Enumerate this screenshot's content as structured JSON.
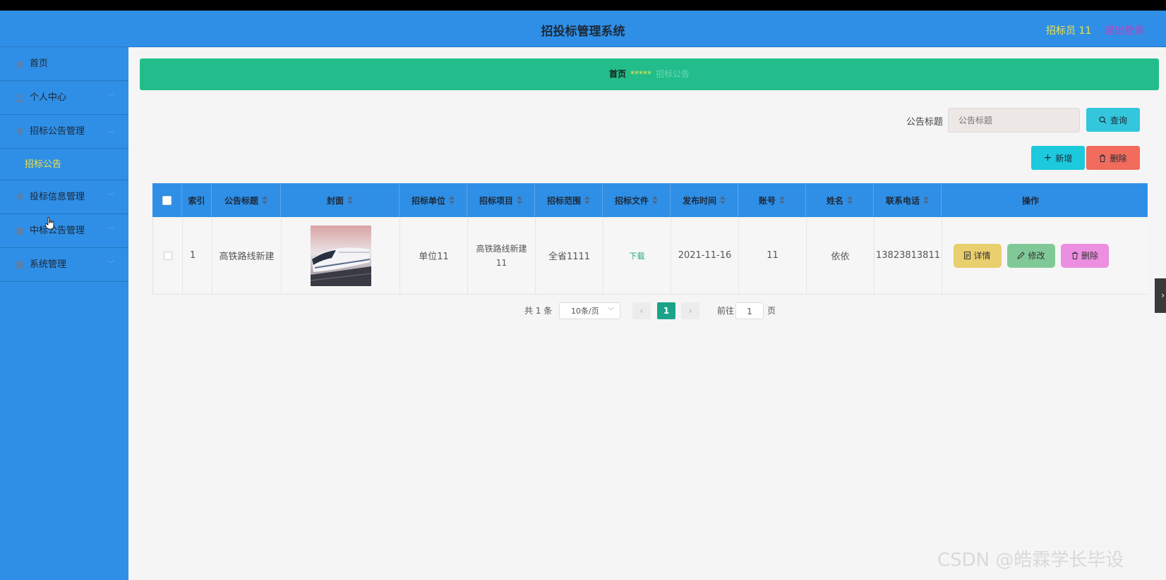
{
  "header": {
    "title": "招投标管理系统",
    "user": "招标员 11",
    "logout": "退出登录"
  },
  "sidebar": {
    "items": [
      {
        "label": "首页",
        "icon": "home-icon"
      },
      {
        "label": "个人中心",
        "icon": "user-icon"
      },
      {
        "label": "招标公告管理",
        "icon": "pin-icon"
      },
      {
        "label": "招标公告",
        "icon": ""
      },
      {
        "label": "投标信息管理",
        "icon": "pin-icon"
      },
      {
        "label": "中标公告管理",
        "icon": "book-icon"
      },
      {
        "label": "系统管理",
        "icon": "grid-icon"
      }
    ]
  },
  "breadcrumb": {
    "home": "首页",
    "separator": "*****",
    "current": "招标公告"
  },
  "search": {
    "label": "公告标题",
    "placeholder": "公告标题",
    "button": "查询"
  },
  "actions": {
    "add": "新增",
    "delete": "删除"
  },
  "table": {
    "headers": [
      "索引",
      "公告标题",
      "封面",
      "招标单位",
      "招标项目",
      "招标范围",
      "招标文件",
      "发布时间",
      "账号",
      "姓名",
      "联系电话",
      "操作"
    ],
    "rows": [
      {
        "index": "1",
        "title": "高铁路线新建",
        "unit": "单位11",
        "project": "高铁路线新建11",
        "scope": "全省1111",
        "file": "下载",
        "date": "2021-11-16",
        "account": "11",
        "name": "依依",
        "phone": "13823813811",
        "ops": {
          "detail": "详情",
          "edit": "修改",
          "delete": "删除"
        }
      }
    ]
  },
  "pagination": {
    "total": "共 1 条",
    "page_size": "10条/页",
    "current": "1",
    "goto_label": "前往",
    "goto_value": "1",
    "page_unit": "页"
  },
  "watermark": "CSDN @皓霖学长毕设",
  "colors": {
    "header": "#2f8fe6",
    "breadcrumb": "#22bd8a",
    "accent_yellow": "#f0e24a"
  }
}
